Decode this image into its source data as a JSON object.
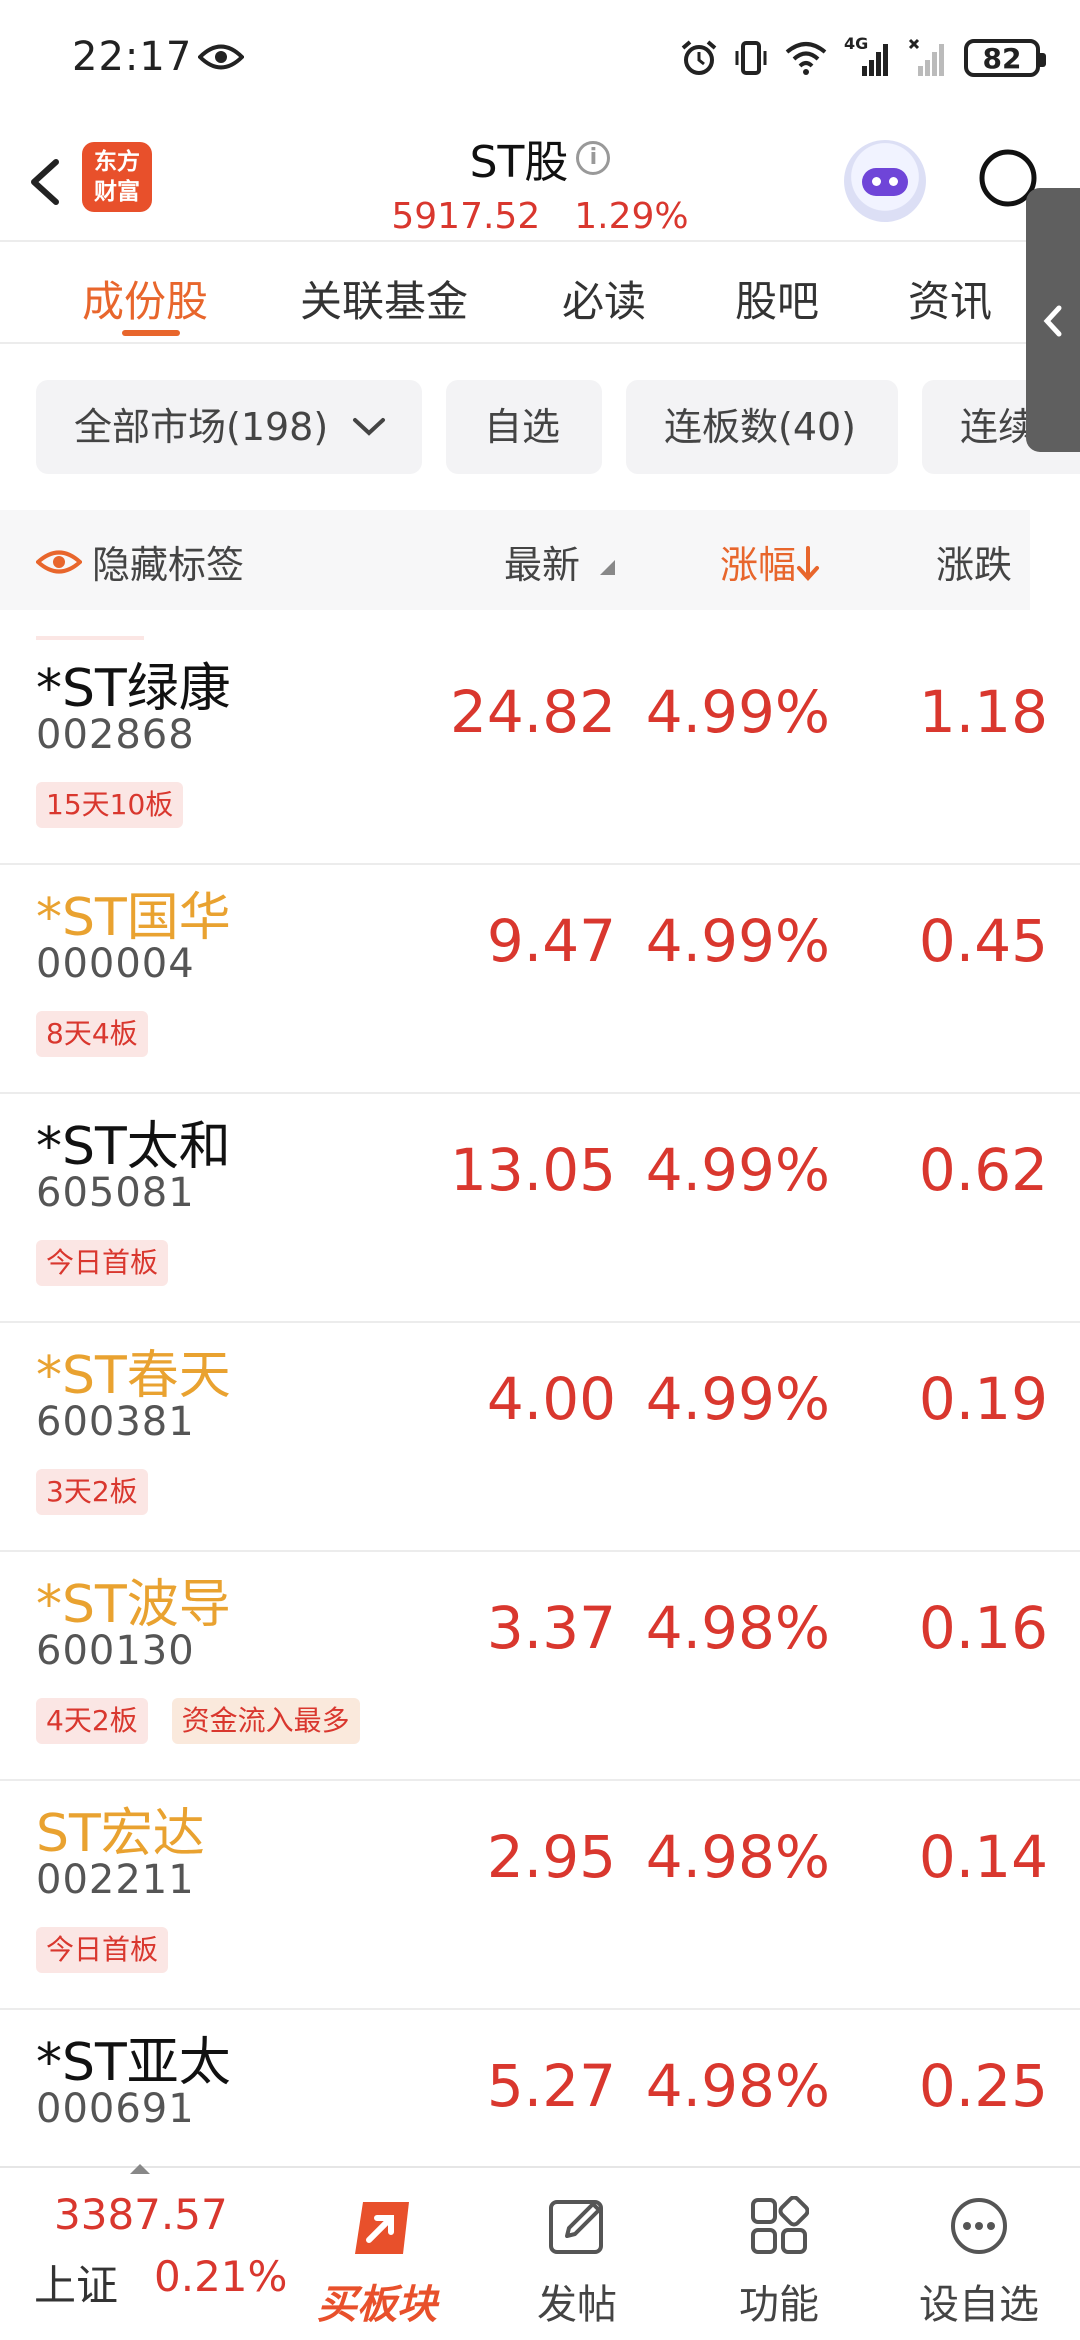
{
  "status_bar": {
    "time": "22:17",
    "network": "4G",
    "battery": "82"
  },
  "header": {
    "logo_text_line1": "东方",
    "logo_text_line2": "财富",
    "title": "ST股",
    "info_glyph": "i",
    "index_value": "5917.52",
    "index_change": "1.29%"
  },
  "tabs": [
    "成份股",
    "关联基金",
    "必读",
    "股吧",
    "资讯"
  ],
  "filters": {
    "market": "全部市场(198)",
    "watchlist": "自选",
    "limit_up_count": "连板数(40)",
    "consecutive": "连续"
  },
  "columns": {
    "hide_tags": "隐藏标签",
    "latest": "最新",
    "change_pct": "涨幅",
    "change": "涨跌"
  },
  "stocks": [
    {
      "name": "*ST绿康",
      "code": "002868",
      "price": "24.82",
      "pct": "4.99%",
      "change": "1.18",
      "tags": [
        "15天10板"
      ],
      "highlight": false
    },
    {
      "name": "*ST国华",
      "code": "000004",
      "price": "9.47",
      "pct": "4.99%",
      "change": "0.45",
      "tags": [
        "8天4板"
      ],
      "highlight": true
    },
    {
      "name": "*ST太和",
      "code": "605081",
      "price": "13.05",
      "pct": "4.99%",
      "change": "0.62",
      "tags": [
        "今日首板"
      ],
      "highlight": false
    },
    {
      "name": "*ST春天",
      "code": "600381",
      "price": "4.00",
      "pct": "4.99%",
      "change": "0.19",
      "tags": [
        "3天2板"
      ],
      "highlight": true
    },
    {
      "name": "*ST波导",
      "code": "600130",
      "price": "3.37",
      "pct": "4.98%",
      "change": "0.16",
      "tags": [
        "4天2板",
        "资金流入最多"
      ],
      "highlight": true
    },
    {
      "name": "ST宏达",
      "code": "002211",
      "price": "2.95",
      "pct": "4.98%",
      "change": "0.14",
      "tags": [
        "今日首板"
      ],
      "highlight": true
    },
    {
      "name": "*ST亚太",
      "code": "000691",
      "price": "5.27",
      "pct": "4.98%",
      "change": "0.25",
      "tags": [],
      "highlight": false
    }
  ],
  "bottom_bar": {
    "index_value": "3387.57",
    "index_name": "上证",
    "index_pct": "0.21%",
    "nav": [
      {
        "label": "买板块",
        "icon": "buy-sector-icon"
      },
      {
        "label": "发帖",
        "icon": "edit-post-icon"
      },
      {
        "label": "功能",
        "icon": "grid-functions-icon"
      },
      {
        "label": "设自选",
        "icon": "more-dots-icon"
      }
    ]
  },
  "colors": {
    "up_red": "#d9372e",
    "accent_orange": "#e8662c",
    "st_yellow": "#e9a230",
    "brand": "#e8502b"
  }
}
